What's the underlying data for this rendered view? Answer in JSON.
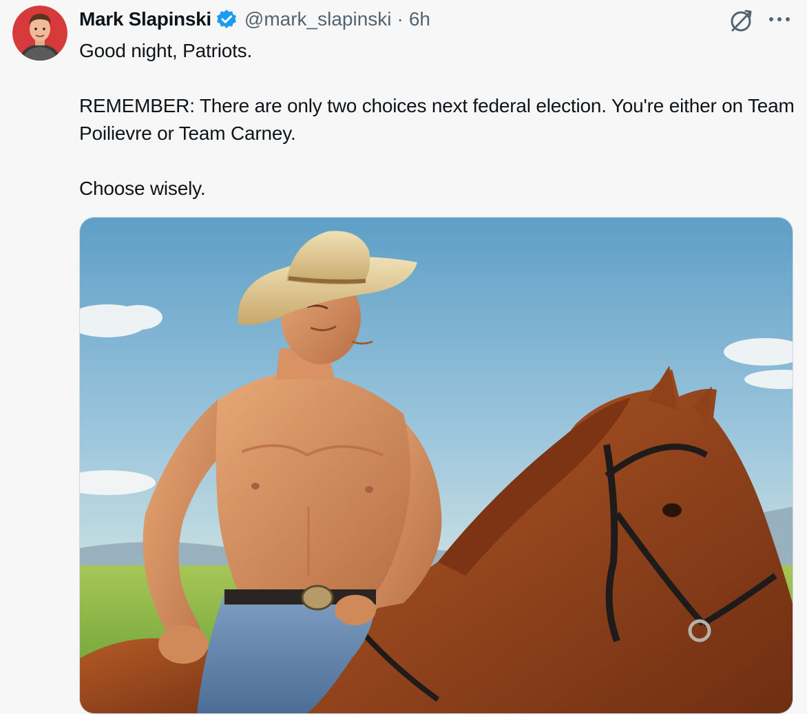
{
  "post": {
    "author": {
      "display_name": "Mark Slapinski",
      "handle": "@mark_slapinski",
      "separator": "·",
      "time": "6h",
      "verified_icon": "verified-badge-icon"
    },
    "text": {
      "line1": "Good night, Patriots.",
      "line2": "REMEMBER: There are only two choices next federal election. You're either on Team Poilievre or Team Carney.",
      "line3": "Choose wisely."
    },
    "actions": {
      "grok_icon": "grok-icon",
      "more_icon": "more-options-icon"
    },
    "media": {
      "type": "image"
    }
  },
  "colors": {
    "background": "#f7f7f7",
    "text_primary": "#0f1419",
    "text_secondary": "#536471",
    "verified_blue": "#1d9bf0",
    "media_border": "#cfd9de"
  }
}
